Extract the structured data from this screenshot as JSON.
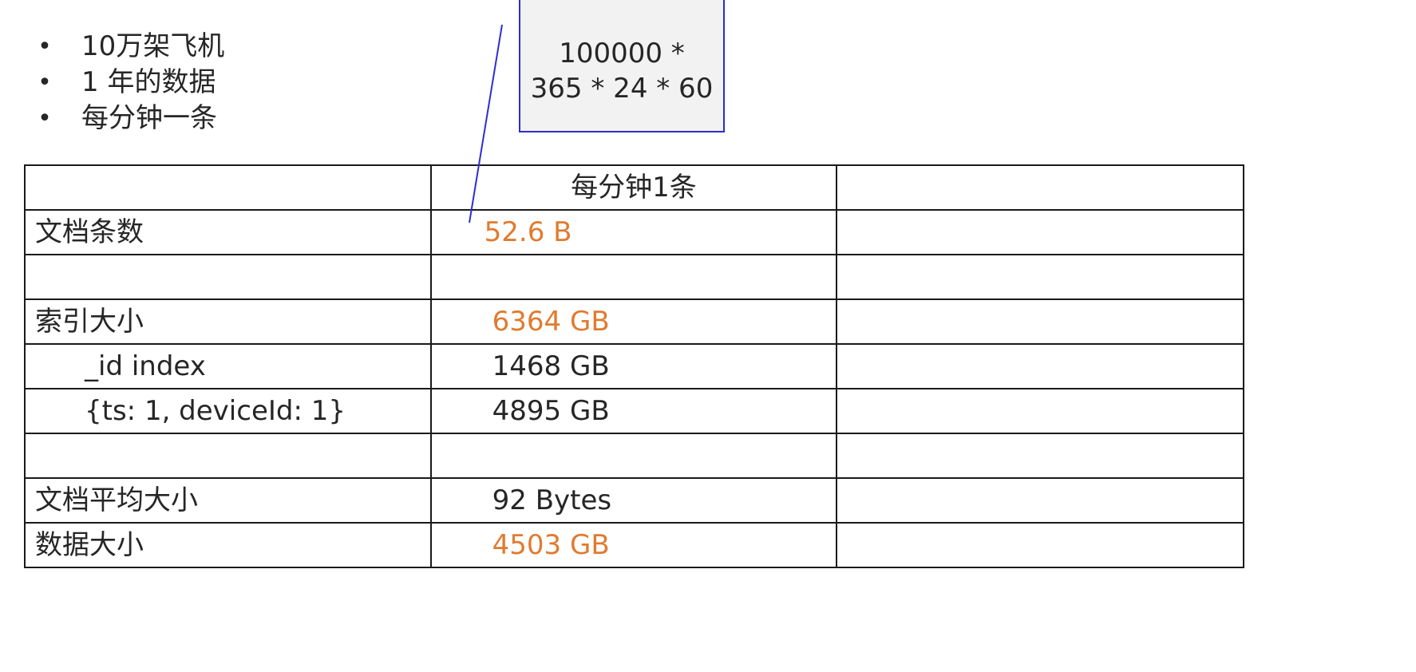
{
  "bullets": [
    {
      "marker": "•",
      "text": "10万架飞机"
    },
    {
      "marker": "•",
      "text": "1 年的数据"
    },
    {
      "marker": "•",
      "text": "每分钟一条"
    }
  ],
  "callout": {
    "line1": "100000 *",
    "line2": "365 * 24 * 60"
  },
  "table": {
    "header": {
      "col1": "",
      "col2": "每分钟1条",
      "col3": ""
    },
    "rows": [
      {
        "label": "文档条数",
        "value": "52.6 B"
      },
      {
        "label": "",
        "value": ""
      },
      {
        "label": "索引大小",
        "value": "6364 GB"
      },
      {
        "label": "_id index",
        "value": "1468 GB"
      },
      {
        "label": "{ts: 1, deviceId: 1}",
        "value": "4895 GB"
      },
      {
        "label": "",
        "value": ""
      },
      {
        "label": "文档平均大小",
        "value": "92 Bytes"
      },
      {
        "label": "数据大小",
        "value": "4503 GB"
      }
    ]
  },
  "colors": {
    "highlight": "#e07b30",
    "text": "#262626",
    "border": "#1a1a1a",
    "callout_border": "#2d2dd1",
    "callout_fill": "#f2f2f2"
  }
}
